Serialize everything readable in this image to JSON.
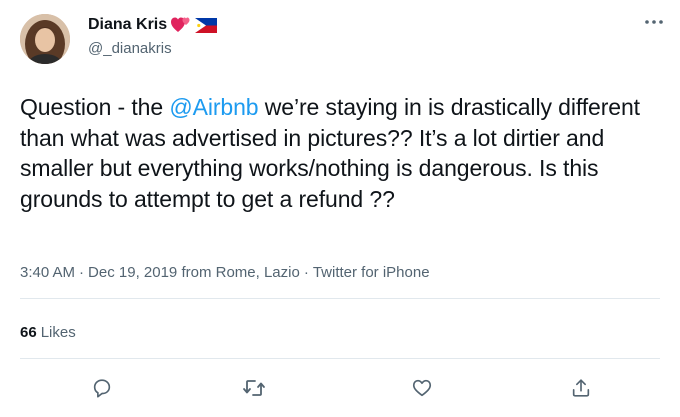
{
  "author": {
    "display_name": "Diana Kris",
    "handle": "@_dianakris",
    "name_emojis": [
      "two-hearts-emoji",
      "philippines-flag-emoji"
    ]
  },
  "tweet": {
    "text_before_mention": "Question - the ",
    "mention": "@Airbnb",
    "text_after_mention": " we’re staying in is drastically different than what was advertised in pictures?? It’s a lot dirtier and smaller but everything works/nothing is dangerous. Is this grounds to attempt to get a refund ??"
  },
  "meta": {
    "time": "3:40 AM",
    "date": "Dec 19, 2019",
    "location": "from Rome, Lazio",
    "source": "Twitter for iPhone",
    "separator": "·"
  },
  "stats": {
    "likes_count": "66",
    "likes_label": "Likes"
  },
  "actions": [
    "reply-icon",
    "retweet-icon",
    "like-icon",
    "share-icon"
  ],
  "colors": {
    "text": "#0f1419",
    "secondary": "#536471",
    "link": "#1d9bf0",
    "divider": "#e1e8ed"
  }
}
